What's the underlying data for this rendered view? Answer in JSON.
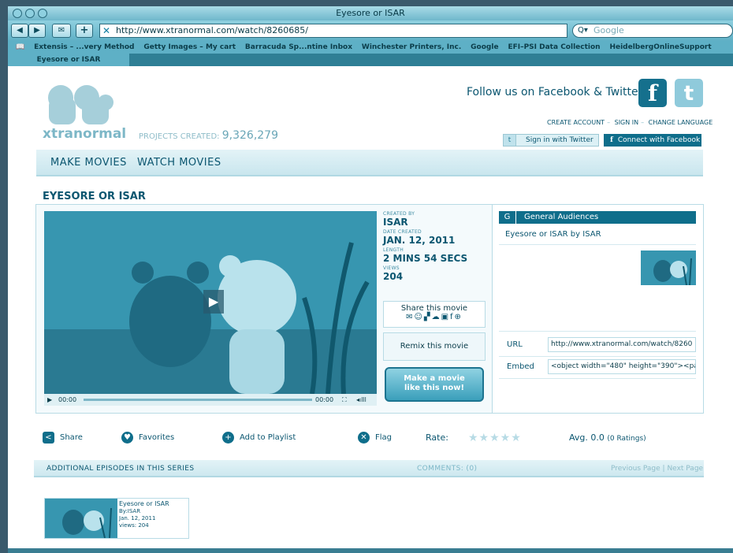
{
  "window": {
    "title": "Eyesore or ISAR"
  },
  "toolbar": {
    "back": "◀",
    "forward": "▶",
    "url": "http://www.xtranormal.com/watch/8260685/",
    "search_placeholder": "Google"
  },
  "bookmarks": [
    "Extensis – ...very Method",
    "Getty Images – My cart",
    "Barracuda Sp...ntine Inbox",
    "Winchester Printers, Inc.",
    "Google",
    "EFI–PSI Data Collection",
    "HeidelbergOnlineSupport"
  ],
  "tab": {
    "label": "Eyesore or ISAR"
  },
  "header": {
    "logo_text": "xtranormal",
    "projects_label": "PROJECTS CREATED:",
    "projects_count": "9,326,279",
    "follow": "Follow us on Facebook & Twitter!",
    "links": {
      "create": "CREATE ACCOUNT",
      "signin": "SIGN IN",
      "language": "CHANGE LANGUAGE"
    },
    "twitter_button": "Sign in with Twitter",
    "facebook_button": "Connect with Facebook"
  },
  "nav": {
    "make": "MAKE MOVIES",
    "watch": "WATCH MOVIES"
  },
  "movie": {
    "title": "EYESORE OR ISAR",
    "created_by_label": "CREATED BY",
    "created_by": "ISAR",
    "date_label": "DATE CREATED",
    "date": "JAN. 12, 2011",
    "length_label": "LENGTH",
    "length": "2 MINS 54 SECS",
    "views_label": "VIEWS",
    "views": "204",
    "share_label": "Share this movie",
    "remix_label": "Remix this movie",
    "make_line1": "Make a movie",
    "make_line2": "like this now!",
    "time_current": "00:00",
    "time_total": "00:00"
  },
  "panel": {
    "rating_code": "G",
    "rating_name": "General Audiences",
    "title_by": "Eyesore or ISAR by ISAR",
    "url_label": "URL",
    "url_value": "http://www.xtranormal.com/watch/8260",
    "embed_label": "Embed",
    "embed_value": "<object width=\"480\" height=\"390\"><pa"
  },
  "actions": {
    "share": "Share",
    "favorites": "Favorites",
    "playlist": "Add to Playlist",
    "flag": "Flag",
    "rate": "Rate:",
    "stars_filled": 0,
    "stars_total": 5,
    "avg_label": "Avg. 0.0",
    "ratings": "(0 Ratings)"
  },
  "episodes": {
    "header": "ADDITIONAL EPISODES IN THIS SERIES",
    "comments": "COMMENTS: (0)",
    "prev": "Previous Page",
    "next": "Next Page",
    "items": [
      {
        "title": "Eyesore or ISAR",
        "by": "By:ISAR",
        "date": "Jan. 12, 2011",
        "views": "views: 204"
      }
    ]
  },
  "colors": {
    "accent": "#0f6e8b",
    "chrome": "#5eb0c6",
    "link": "#0b5670"
  }
}
